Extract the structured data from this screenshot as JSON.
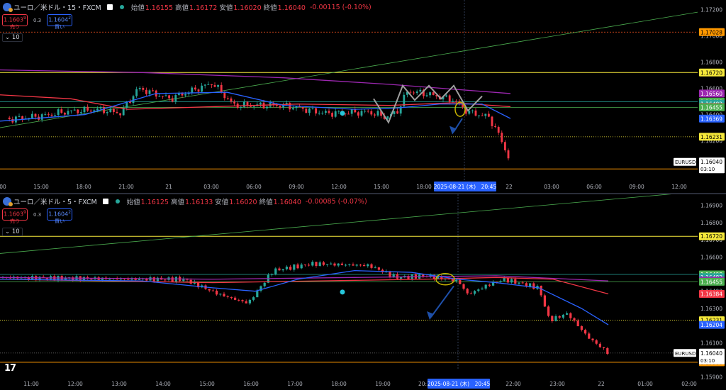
{
  "colors": {
    "up": "#26a69a",
    "down": "#f23645",
    "ma_blue": "#2962ff",
    "ma_red": "#f23645",
    "ma_purple": "#9c27b0",
    "trend_green": "#4caf50",
    "level_yellow": "#f5e83a",
    "level_orange": "#ff9800",
    "zigzag_gray": "#9e9e9e",
    "arrow_blue": "#1e4fa8"
  },
  "chart_data": [
    {
      "type": "candlestick",
      "header": {
        "symbol": "ユーロ／米ドル・15・FXCM",
        "open_label": "始値",
        "open": "1.16155",
        "high_label": "高値",
        "high": "1.16172",
        "low_label": "安値",
        "low": "1.16020",
        "close_label": "終値",
        "close": "1.16040",
        "change": "-0.00115 (-0.10%)"
      },
      "trade": {
        "sell_price": "1.1603",
        "sell_sup": "9",
        "sell_label": "売り",
        "spread": "0.3",
        "buy_price": "1.1604",
        "buy_sup": "2",
        "buy_label": "買い"
      },
      "collapse_label": "10",
      "ylim": [
        1.1589,
        1.1724
      ],
      "y_ticks": [
        "1.17200",
        "1.17000",
        "1.16800",
        "1.16600",
        "1.16400",
        "1.16200"
      ],
      "x_ticks": [
        "00",
        "15:00",
        "18:00",
        "21:00",
        "21",
        "03:00",
        "06:00",
        "09:00",
        "12:00",
        "15:00",
        "18:00",
        "22",
        "03:00",
        "06:00",
        "09:00",
        "12:00"
      ],
      "crosshair_label": "2025-08-21 (木)　20:45",
      "price_tags": [
        {
          "text": "1.17028",
          "value": 1.17028,
          "bg": "#ff9800",
          "fg": "#000"
        },
        {
          "text": "1.16720",
          "value": 1.1672,
          "bg": "#f5e83a",
          "fg": "#000"
        },
        {
          "text": "1.16560",
          "value": 1.1656,
          "bg": "#9c27b0",
          "fg": "#fff"
        },
        {
          "text": "1.16498",
          "value": 1.16498,
          "bg": "#4caf50",
          "fg": "#fff"
        },
        {
          "text": "1.16482",
          "value": 1.16482,
          "bg": "#26a69a",
          "fg": "#fff"
        },
        {
          "text": "1.16458",
          "value": 1.16458,
          "bg": "#f23645",
          "fg": "#fff"
        },
        {
          "text": "1.16455",
          "value": 1.16455,
          "bg": "#4caf50",
          "fg": "#fff"
        },
        {
          "text": "1.16369",
          "value": 1.16369,
          "bg": "#2962ff",
          "fg": "#fff"
        },
        {
          "text": "1.16231",
          "value": 1.16231,
          "bg": "#f5e83a",
          "fg": "#000"
        },
        {
          "text": "1.15986",
          "value": 1.15986,
          "bg": "#ff9800",
          "fg": "#000"
        }
      ],
      "last_price": {
        "symbol": "EURUSD",
        "price": "1.16040",
        "countdown": "03:10",
        "value": 1.1604
      }
    },
    {
      "type": "candlestick",
      "header": {
        "symbol": "ユーロ／米ドル・5・FXCM",
        "open_label": "始値",
        "open": "1.16125",
        "high_label": "高値",
        "high": "1.16133",
        "low_label": "安値",
        "low": "1.16020",
        "close_label": "終値",
        "close": "1.16040",
        "change": "-0.00085 (-0.07%)"
      },
      "trade": {
        "sell_price": "1.1603",
        "sell_sup": "9",
        "sell_label": "売り",
        "spread": "0.3",
        "buy_price": "1.1604",
        "buy_sup": "2",
        "buy_label": "買い"
      },
      "collapse_label": "10",
      "ylim": [
        1.1594,
        1.1694
      ],
      "y_ticks": [
        "1.16900",
        "1.16800",
        "1.16700",
        "1.16600",
        "1.16500",
        "1.16400",
        "1.16300",
        "1.16200",
        "1.16100",
        "1.16000",
        "1.15900"
      ],
      "x_ticks": [
        "11:00",
        "12:00",
        "13:00",
        "14:00",
        "15:00",
        "16:00",
        "17:00",
        "18:00",
        "19:00",
        "20:",
        "22:00",
        "23:00",
        "22",
        "01:00",
        "02:00"
      ],
      "crosshair_label": "2025-08-21 (木)　20:45",
      "price_tags": [
        {
          "text": "1.16720",
          "value": 1.1672,
          "bg": "#f5e83a",
          "fg": "#000"
        },
        {
          "text": "1.16498",
          "value": 1.16498,
          "bg": "#4caf50",
          "fg": "#fff"
        },
        {
          "text": "1.16482",
          "value": 1.16482,
          "bg": "#26a69a",
          "fg": "#fff"
        },
        {
          "text": "1.16462",
          "value": 1.16462,
          "bg": "#9c27b0",
          "fg": "#fff"
        },
        {
          "text": "1.16455",
          "value": 1.16455,
          "bg": "#4caf50",
          "fg": "#fff"
        },
        {
          "text": "1.16384",
          "value": 1.16384,
          "bg": "#f23645",
          "fg": "#fff"
        },
        {
          "text": "1.16231",
          "value": 1.16231,
          "bg": "#f5e83a",
          "fg": "#000"
        },
        {
          "text": "1.16204",
          "value": 1.16204,
          "bg": "#2962ff",
          "fg": "#fff"
        },
        {
          "text": "1.15986",
          "value": 1.15986,
          "bg": "#ff9800",
          "fg": "#000"
        }
      ],
      "last_price": {
        "symbol": "EURUSD",
        "price": "1.16040",
        "countdown": "03:10",
        "value": 1.1604
      }
    }
  ],
  "bottom": {
    "logo": "17",
    "settings_icon": "gear-icon"
  }
}
